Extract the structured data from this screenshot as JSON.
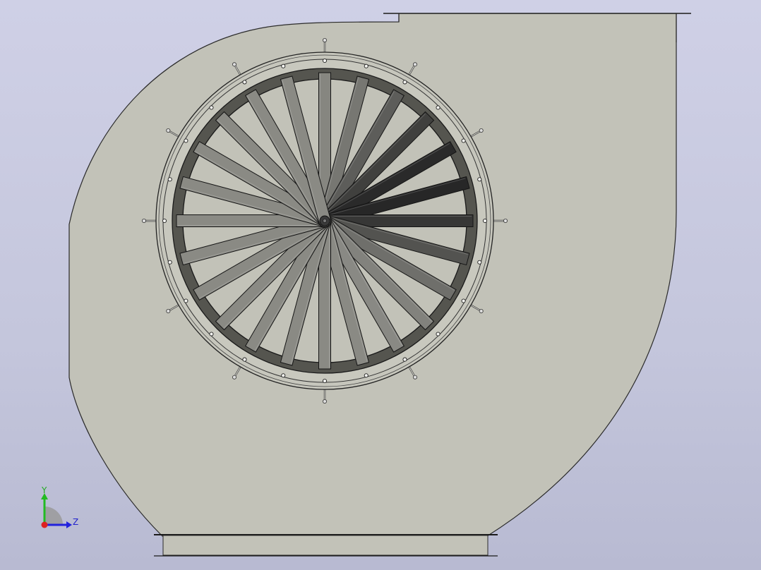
{
  "viewport": {
    "background_top": "#cfd0e6",
    "background_bottom": "#b8bad2"
  },
  "model": {
    "description_visible": false,
    "housing_color": "#c2c2b8",
    "housing_edge_color": "#2a2a2a",
    "impeller_blade_count": 24,
    "flange_bolt_count": 24,
    "bracket_count": 12,
    "blade_color_light": "#8a8a84",
    "blade_color_dark": "#262626",
    "rim_color": "#55554f"
  },
  "triad": {
    "y_label": "Y",
    "z_label": "Z",
    "y_color": "#22bb22",
    "z_color": "#2222dd",
    "x_color": "#dd2222"
  }
}
